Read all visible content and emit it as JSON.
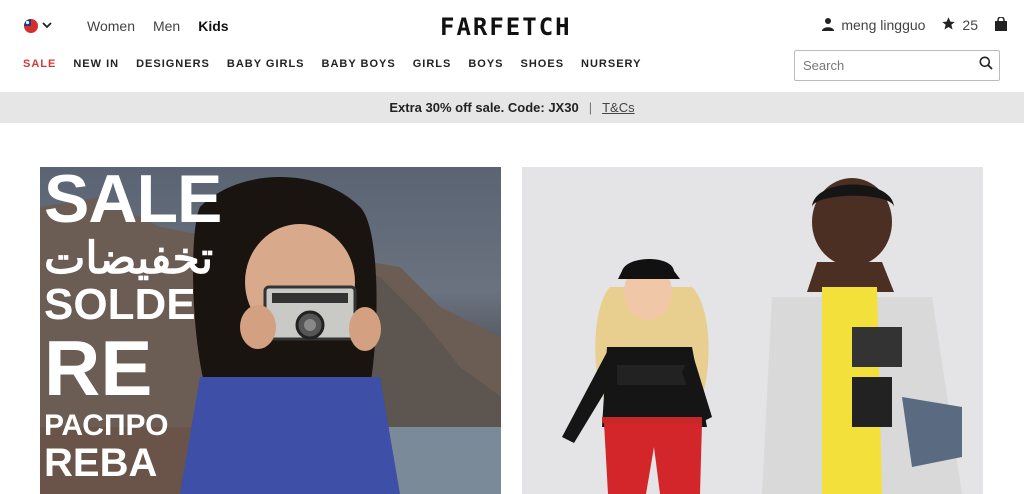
{
  "header": {
    "region_flag": "taiwan-flag",
    "gender_nav": [
      "Women",
      "Men",
      "Kids"
    ],
    "active_gender": "Kids",
    "logo": "FARFETCH",
    "user_name": "meng lingguo",
    "wishlist_count": "25"
  },
  "categories": {
    "items": [
      "SALE",
      "NEW IN",
      "DESIGNERS",
      "BABY GIRLS",
      "BABY BOYS",
      "GIRLS",
      "BOYS",
      "SHOES",
      "NURSERY"
    ],
    "sale_color": "#d1383b"
  },
  "search": {
    "placeholder": "Search"
  },
  "promo": {
    "text": "Extra 30% off sale. Code: JX30",
    "separator": "|",
    "link": "T&Cs"
  },
  "hero": {
    "left_banner": {
      "lines": [
        "SALE",
        "تخفيضات",
        "SOLDE",
        "RE",
        "РАСПРО",
        "REBA"
      ]
    }
  }
}
